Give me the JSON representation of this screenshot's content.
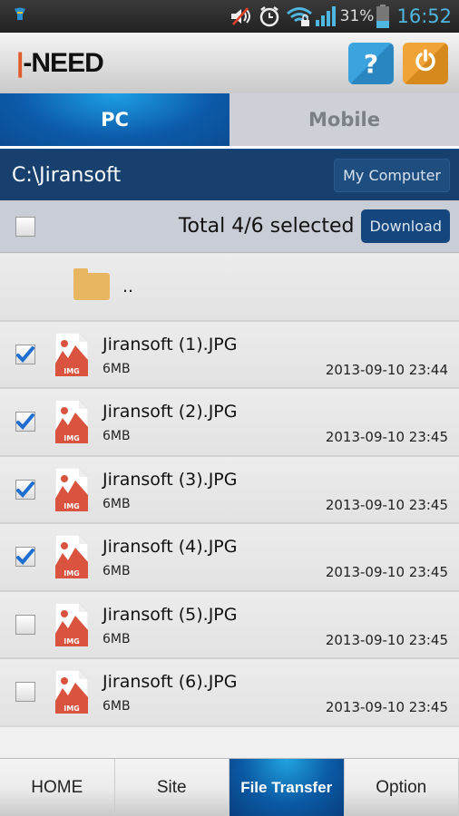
{
  "status_bar": {
    "battery_percent": "31%",
    "time": "16:52",
    "icons": [
      "app-notification-icon",
      "mute-icon",
      "alarm-icon",
      "wifi-locked-icon",
      "signal-icon",
      "battery-icon"
    ]
  },
  "header": {
    "logo": "I-NEED",
    "help_label": "?",
    "power_icon": "power-icon"
  },
  "tabs": [
    {
      "label": "PC",
      "active": true
    },
    {
      "label": "Mobile",
      "active": false
    }
  ],
  "path_bar": {
    "path": "C:\\Jiransoft",
    "my_computer_label": "My Computer"
  },
  "selection_bar": {
    "select_all_checked": false,
    "summary": "Total 4/6 selected",
    "download_label": "Download"
  },
  "parent_folder": {
    "label": ".."
  },
  "files": [
    {
      "name": "Jiransoft (1).JPG",
      "size": "6MB",
      "date": "2013-09-10 23:44",
      "checked": true,
      "badge": "IMG"
    },
    {
      "name": "Jiransoft (2).JPG",
      "size": "6MB",
      "date": "2013-09-10 23:45",
      "checked": true,
      "badge": "IMG"
    },
    {
      "name": "Jiransoft (3).JPG",
      "size": "6MB",
      "date": "2013-09-10 23:45",
      "checked": true,
      "badge": "IMG"
    },
    {
      "name": "Jiransoft (4).JPG",
      "size": "6MB",
      "date": "2013-09-10 23:45",
      "checked": true,
      "badge": "IMG"
    },
    {
      "name": "Jiransoft (5).JPG",
      "size": "6MB",
      "date": "2013-09-10 23:45",
      "checked": false,
      "badge": "IMG"
    },
    {
      "name": "Jiransoft (6).JPG",
      "size": "6MB",
      "date": "2013-09-10 23:45",
      "checked": false,
      "badge": "IMG"
    }
  ],
  "bottom_nav": [
    {
      "label": "HOME",
      "active": false
    },
    {
      "label": "Site",
      "active": false
    },
    {
      "label": "File Transfer",
      "active": true
    },
    {
      "label": "Option",
      "active": false
    }
  ],
  "colors": {
    "primary_blue": "#0c5aa8",
    "path_bar": "#17406f",
    "help_button": "#3ba3de",
    "power_button": "#f0a336",
    "img_icon_red": "#d9533f",
    "status_time": "#4fb6e0"
  }
}
